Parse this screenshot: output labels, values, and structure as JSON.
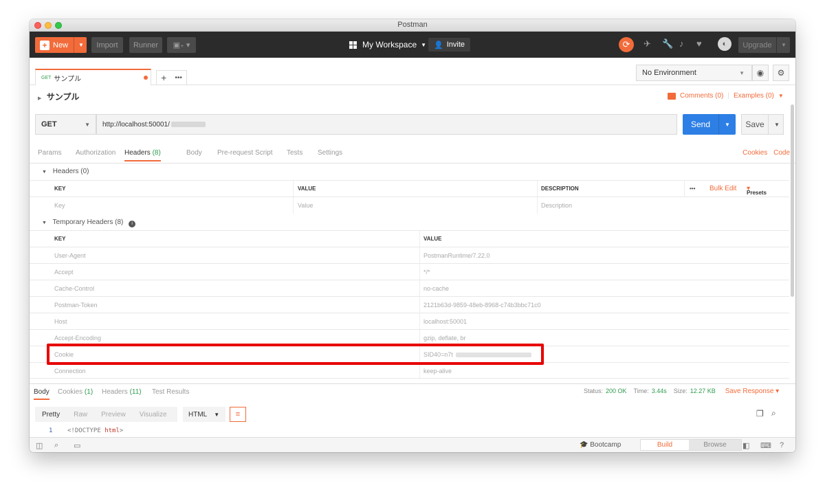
{
  "window": {
    "title": "Postman"
  },
  "header": {
    "new_label": "New",
    "import_label": "Import",
    "runner_label": "Runner",
    "workspace_label": "My Workspace",
    "invite_label": "Invite",
    "upgrade_label": "Upgrade"
  },
  "tabs": {
    "request_tab": {
      "method": "GET",
      "name": "サンプル"
    },
    "environment": "No Environment"
  },
  "request": {
    "name": "サンプル",
    "comments": "Comments (0)",
    "examples": "Examples (0)",
    "method": "GET",
    "url": "http://localhost:50001/",
    "send_label": "Send",
    "save_label": "Save"
  },
  "request_tabs": {
    "params": "Params",
    "authorization": "Authorization",
    "headers": "Headers",
    "headers_count": "(8)",
    "body": "Body",
    "prerequest": "Pre-request Script",
    "tests": "Tests",
    "settings": "Settings",
    "cookies": "Cookies",
    "code": "Code"
  },
  "headers_section": {
    "title": "Headers (0)",
    "col_key": "KEY",
    "col_value": "VALUE",
    "col_description": "DESCRIPTION",
    "bulk_edit": "Bulk Edit",
    "presets": "Presets",
    "placeholder_key": "Key",
    "placeholder_value": "Value",
    "placeholder_description": "Description"
  },
  "temp_headers": {
    "title": "Temporary Headers (8)",
    "col_key": "KEY",
    "col_value": "VALUE",
    "rows": [
      {
        "key": "User-Agent",
        "value": "PostmanRuntime/7.22.0"
      },
      {
        "key": "Accept",
        "value": "*/*"
      },
      {
        "key": "Cache-Control",
        "value": "no-cache"
      },
      {
        "key": "Postman-Token",
        "value": "2121b63d-9859-48eb-8968-c74b3bbc71c0"
      },
      {
        "key": "Host",
        "value": "localhost:50001"
      },
      {
        "key": "Accept-Encoding",
        "value": "gzip, deflate, br"
      },
      {
        "key": "Cookie",
        "value": "SID40=n7t"
      },
      {
        "key": "Connection",
        "value": "keep-alive"
      }
    ]
  },
  "response": {
    "tabs": {
      "body": "Body",
      "cookies": "Cookies",
      "cookies_count": "(1)",
      "headers": "Headers",
      "headers_count": "(11)",
      "test_results": "Test Results"
    },
    "status_label": "Status:",
    "status_value": "200 OK",
    "time_label": "Time:",
    "time_value": "3.44s",
    "size_label": "Size:",
    "size_value": "12.27 KB",
    "save_response": "Save Response",
    "formats": {
      "pretty": "Pretty",
      "raw": "Raw",
      "preview": "Preview",
      "visualize": "Visualize",
      "language": "HTML"
    },
    "code_line_number": "1",
    "code_line": "<!DOCTYPE html>"
  },
  "statusbar": {
    "bootcamp": "Bootcamp",
    "build": "Build",
    "browse": "Browse"
  },
  "colors": {
    "accent": "#f26b3a",
    "send_blue": "#2d7fe5",
    "success_green": "#2e9b4e",
    "highlight_red": "#e80000"
  }
}
